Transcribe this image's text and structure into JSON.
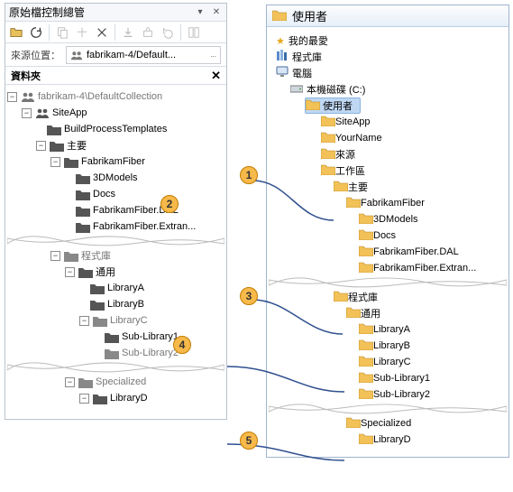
{
  "colors": {
    "bubble_fill": "#f6b94a",
    "bubble_border": "#c27c00",
    "connector": "#2f4f8f",
    "sel_bg": "#bfd7f3",
    "sel_border": "#8ab4e0"
  },
  "left": {
    "title": "原始檔控制總管",
    "source_label": "來源位置：",
    "source_value": "fabrikam-4/Default...",
    "folders_header": "資料夾",
    "root": "fabrikam-4\\DefaultCollection",
    "tree": {
      "n0": "SiteApp",
      "n1": "BuildProcessTemplates",
      "n2": "主要",
      "n3": "FabrikamFiber",
      "n4": "3DModels",
      "n5": "Docs",
      "n6": "FabrikamFiber.DAL",
      "n7": "FabrikamFiber.Extran...",
      "n8": "程式庫",
      "n9": "通用",
      "n10": "LibraryA",
      "n11": "LibraryB",
      "n12": "LibraryC",
      "n13": "Sub-Library1",
      "n14": "Sub-Library2",
      "n15": "Specialized",
      "n16": "LibraryD"
    }
  },
  "right": {
    "title": "使用者",
    "fav": "我的最愛",
    "lib": "程式庫",
    "computer": "電腦",
    "disk": "本機磁碟 (C:)",
    "users": "使用者",
    "tree": {
      "r0": "SiteApp",
      "r1": "YourName",
      "r2": "來源",
      "r3": "工作區",
      "r4": "主要",
      "r5": "FabrikamFiber",
      "r6": "3DModels",
      "r7": "Docs",
      "r8": "FabrikamFiber.DAL",
      "r9": "FabrikamFiber.Extran...",
      "r10": "程式庫",
      "r11": "通用",
      "r12": "LibraryA",
      "r13": "LibraryB",
      "r14": "LibraryC",
      "r15": "Sub-Library1",
      "r16": "Sub-Library2",
      "r17": "Specialized",
      "r18": "LibraryD"
    }
  },
  "bubbles": {
    "b1": "1",
    "b2": "2",
    "b3": "3",
    "b4": "4",
    "b5": "5"
  }
}
